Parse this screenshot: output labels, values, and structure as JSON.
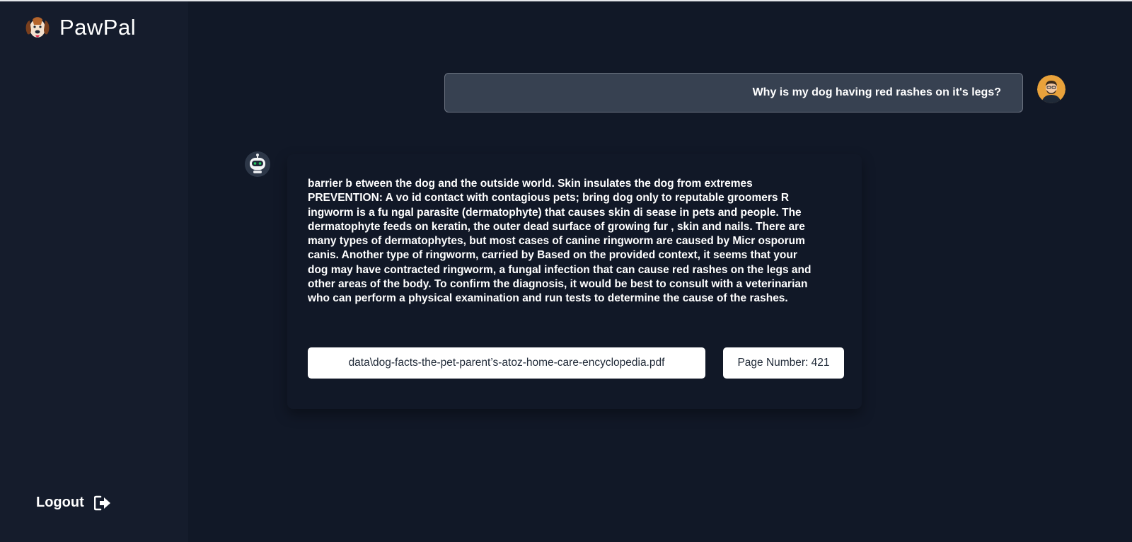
{
  "app": {
    "name": "PawPal"
  },
  "sidebar": {
    "logout_label": "Logout"
  },
  "chat": {
    "user_message": "Why is my dog having red rashes on it's legs?",
    "bot_message": "barrier b etween the dog and the outside world. Skin insulates the dog from extremes\nPREVENTION: A vo id contact with contagious pets; bring dog only to reputable groomers R\ningworm is a fu ngal parasite (dermatophyte) that causes skin di sease in pets and people. The\ndermatophyte feeds on keratin, the outer dead surface of growing fur , skin and nails. There are\nmany types of dermatophytes, but most cases of canine ringworm are caused by Micr osporum\ncanis. Another type of ringworm, carried by Based on the provided context, it seems that your\ndog may have contracted ringworm, a fungal infection that can cause red rashes on the legs and\nother areas of the body. To confirm the diagnosis, it would be best to consult with a veterinarian\nwho can perform a physical examination and run tests to determine the cause of the rashes.",
    "source_file": "data\\dog-facts-the-pet-parent’s-atoz-home-care-encyclopedia.pdf",
    "source_page": "Page Number: 421"
  },
  "icons": {
    "logo": "dog-face-icon",
    "logout": "logout-icon",
    "user_avatar": "user-avatar",
    "bot_avatar": "robot-icon"
  },
  "colors": {
    "background": "#111827",
    "sidebar": "#151c2c",
    "user_bubble": "#374151",
    "chip": "#ffffff"
  }
}
